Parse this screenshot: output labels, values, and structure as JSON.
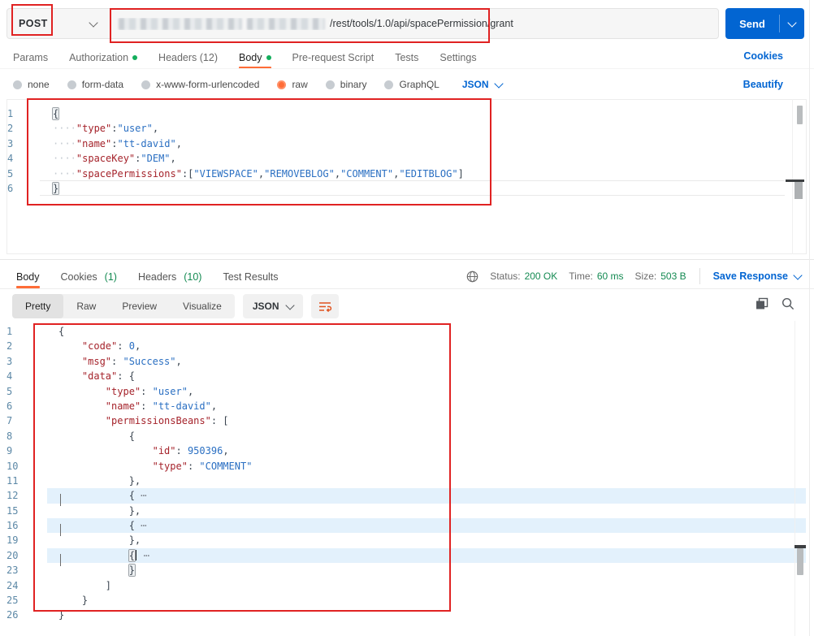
{
  "topbar": {
    "method": "POST",
    "url_visible_path": "/rest/tools/1.0/api/spacePermission/grant",
    "send_label": "Send"
  },
  "request_tabs": {
    "items": [
      {
        "label": "Params"
      },
      {
        "label": "Authorization",
        "dot": true
      },
      {
        "label": "Headers (12)"
      },
      {
        "label": "Body",
        "dot": true,
        "active": true
      },
      {
        "label": "Pre-request Script"
      },
      {
        "label": "Tests"
      },
      {
        "label": "Settings"
      }
    ],
    "cookies_link": "Cookies"
  },
  "body_type_bar": {
    "options": [
      {
        "label": "none"
      },
      {
        "label": "form-data"
      },
      {
        "label": "x-www-form-urlencoded"
      },
      {
        "label": "raw",
        "selected": true
      },
      {
        "label": "binary"
      },
      {
        "label": "GraphQL"
      }
    ],
    "language": "JSON",
    "beautify_link": "Beautify"
  },
  "request_editor": {
    "lines": [
      {
        "n": 1,
        "segs": [
          [
            "bx",
            "{"
          ]
        ]
      },
      {
        "n": 2,
        "segs": [
          [
            "w",
            "····"
          ],
          [
            "k",
            "\"type\""
          ],
          [
            "p",
            ":"
          ],
          [
            "s",
            "\"user\""
          ],
          [
            "p",
            ","
          ]
        ]
      },
      {
        "n": 3,
        "segs": [
          [
            "w",
            "····"
          ],
          [
            "k",
            "\"name\""
          ],
          [
            "p",
            ":"
          ],
          [
            "s",
            "\"tt-david\""
          ],
          [
            "p",
            ","
          ]
        ]
      },
      {
        "n": 4,
        "segs": [
          [
            "w",
            "····"
          ],
          [
            "k",
            "\"spaceKey\""
          ],
          [
            "p",
            ":"
          ],
          [
            "s",
            "\"DEM\""
          ],
          [
            "p",
            ","
          ]
        ]
      },
      {
        "n": 5,
        "segs": [
          [
            "w",
            "····"
          ],
          [
            "k",
            "\"spacePermissions\""
          ],
          [
            "p",
            ":["
          ],
          [
            "s",
            "\"VIEWSPACE\""
          ],
          [
            "p",
            ","
          ],
          [
            "s",
            "\"REMOVEBLOG\""
          ],
          [
            "p",
            ","
          ],
          [
            "s",
            "\"COMMENT\""
          ],
          [
            "p",
            ","
          ],
          [
            "s",
            "\"EDITBLOG\""
          ],
          [
            "p",
            "]"
          ]
        ]
      },
      {
        "n": 6,
        "cl": true,
        "segs": [
          [
            "bx",
            "}"
          ]
        ]
      }
    ]
  },
  "response_header": {
    "tabs": [
      {
        "label": "Body",
        "active": true
      },
      {
        "label": "Cookies",
        "count": "(1)"
      },
      {
        "label": "Headers",
        "count": "(10)"
      },
      {
        "label": "Test Results"
      }
    ],
    "meta": [
      {
        "label": "Status:",
        "value": "200 OK"
      },
      {
        "label": "Time:",
        "value": "60 ms"
      },
      {
        "label": "Size:",
        "value": "503 B"
      }
    ],
    "save_response_label": "Save Response"
  },
  "response_toolbar": {
    "views": [
      {
        "label": "Pretty",
        "active": true
      },
      {
        "label": "Raw"
      },
      {
        "label": "Preview"
      },
      {
        "label": "Visualize"
      }
    ],
    "language": "JSON"
  },
  "response_editor": {
    "lines": [
      {
        "n": 1,
        "segs": [
          [
            "p",
            "{"
          ]
        ]
      },
      {
        "n": 2,
        "segs": [
          [
            "sp",
            "    "
          ],
          [
            "k",
            "\"code\""
          ],
          [
            "p",
            ": "
          ],
          [
            "num",
            "0"
          ],
          [
            "p",
            ","
          ]
        ]
      },
      {
        "n": 3,
        "segs": [
          [
            "sp",
            "    "
          ],
          [
            "k",
            "\"msg\""
          ],
          [
            "p",
            ": "
          ],
          [
            "s",
            "\"Success\""
          ],
          [
            "p",
            ","
          ]
        ]
      },
      {
        "n": 4,
        "segs": [
          [
            "sp",
            "    "
          ],
          [
            "k",
            "\"data\""
          ],
          [
            "p",
            ": {"
          ]
        ]
      },
      {
        "n": 5,
        "segs": [
          [
            "sp",
            "        "
          ],
          [
            "k",
            "\"type\""
          ],
          [
            "p",
            ": "
          ],
          [
            "s",
            "\"user\""
          ],
          [
            "p",
            ","
          ]
        ]
      },
      {
        "n": 6,
        "segs": [
          [
            "sp",
            "        "
          ],
          [
            "k",
            "\"name\""
          ],
          [
            "p",
            ": "
          ],
          [
            "s",
            "\"tt-david\""
          ],
          [
            "p",
            ","
          ]
        ]
      },
      {
        "n": 7,
        "segs": [
          [
            "sp",
            "        "
          ],
          [
            "k",
            "\"permissionsBeans\""
          ],
          [
            "p",
            ": ["
          ]
        ]
      },
      {
        "n": 8,
        "segs": [
          [
            "sp",
            "            "
          ],
          [
            "p",
            "{"
          ]
        ]
      },
      {
        "n": 9,
        "segs": [
          [
            "sp",
            "                "
          ],
          [
            "k",
            "\"id\""
          ],
          [
            "p",
            ": "
          ],
          [
            "num",
            "950396"
          ],
          [
            "p",
            ","
          ]
        ]
      },
      {
        "n": 10,
        "segs": [
          [
            "sp",
            "                "
          ],
          [
            "k",
            "\"type\""
          ],
          [
            "p",
            ": "
          ],
          [
            "s",
            "\"COMMENT\""
          ]
        ]
      },
      {
        "n": 11,
        "segs": [
          [
            "sp",
            "            "
          ],
          [
            "p",
            "},"
          ]
        ]
      },
      {
        "n": 12,
        "fold": true,
        "hl": true,
        "segs": [
          [
            "sp",
            "            "
          ],
          [
            "p",
            "{"
          ],
          [
            "el",
            " ⋯"
          ]
        ]
      },
      {
        "n": 15,
        "segs": [
          [
            "sp",
            "            "
          ],
          [
            "p",
            "},"
          ]
        ]
      },
      {
        "n": 16,
        "fold": true,
        "hl": true,
        "segs": [
          [
            "sp",
            "            "
          ],
          [
            "p",
            "{"
          ],
          [
            "el",
            " ⋯"
          ]
        ]
      },
      {
        "n": 19,
        "segs": [
          [
            "sp",
            "            "
          ],
          [
            "p",
            "},"
          ]
        ]
      },
      {
        "n": 20,
        "fold": true,
        "hl": true,
        "segs": [
          [
            "sp",
            "            "
          ],
          [
            "bx",
            "{"
          ],
          [
            "cur",
            ""
          ],
          [
            "el",
            " ⋯"
          ]
        ]
      },
      {
        "n": 23,
        "segs": [
          [
            "sp",
            "            "
          ],
          [
            "bx",
            "}"
          ]
        ]
      },
      {
        "n": 24,
        "segs": [
          [
            "sp",
            "        "
          ],
          [
            "p",
            "]"
          ]
        ]
      },
      {
        "n": 25,
        "segs": [
          [
            "sp",
            "    "
          ],
          [
            "p",
            "}"
          ]
        ]
      },
      {
        "n": 26,
        "segs": [
          [
            "p",
            "}"
          ]
        ]
      }
    ]
  },
  "colors": {
    "accent_orange": "#ff6c37",
    "link_blue": "#0265d2",
    "send_button_blue": "#0265d2",
    "status_green_text": "#148a52",
    "green_dot": "#13ae5c",
    "annotation_red": "#e02222",
    "json_key": "#a5232b",
    "json_string": "#2a6fc2",
    "json_number": "#2a6fc2",
    "line_number": "#5c88a6"
  }
}
